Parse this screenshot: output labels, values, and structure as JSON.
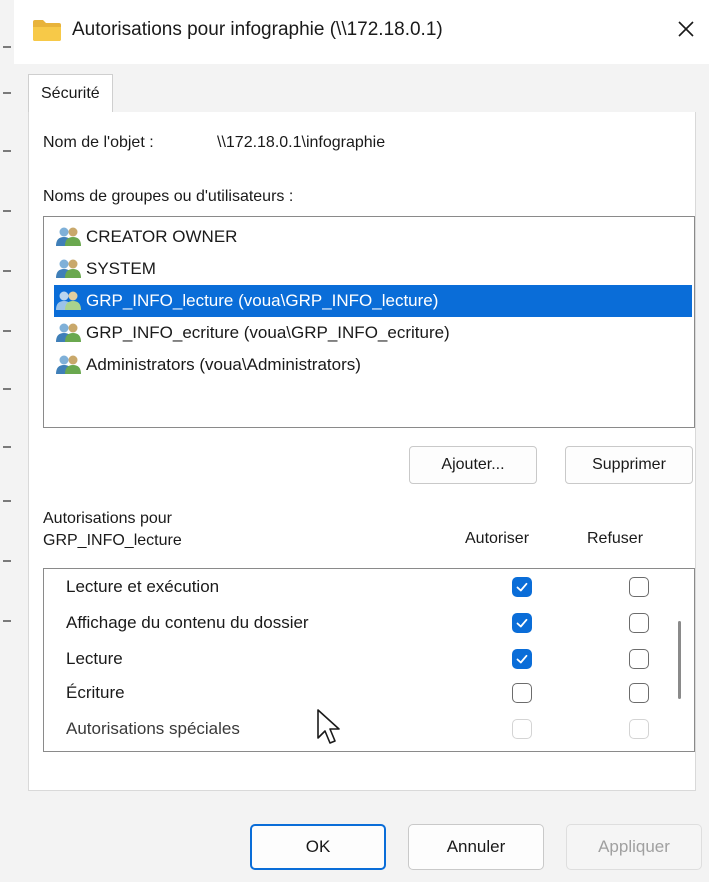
{
  "window": {
    "title": "Autorisations pour infographie (\\\\172.18.0.1)"
  },
  "tabs": [
    {
      "label": "Sécurité"
    }
  ],
  "object": {
    "label": "Nom de l'objet :",
    "value": "\\\\172.18.0.1\\infographie"
  },
  "groups": {
    "label": "Noms de groupes ou d'utilisateurs :",
    "items": [
      {
        "label": "CREATOR OWNER",
        "selected": false,
        "icon": "user-group-icon"
      },
      {
        "label": "SYSTEM",
        "selected": false,
        "icon": "user-group-icon"
      },
      {
        "label": "GRP_INFO_lecture (voua\\GRP_INFO_lecture)",
        "selected": true,
        "icon": "user-group-icon"
      },
      {
        "label": "GRP_INFO_ecriture (voua\\GRP_INFO_ecriture)",
        "selected": false,
        "icon": "user-group-icon"
      },
      {
        "label": "Administrators (voua\\Administrators)",
        "selected": false,
        "icon": "user-group-icon"
      }
    ],
    "add_label": "Ajouter...",
    "remove_label": "Supprimer"
  },
  "permissions": {
    "title_line1": "Autorisations pour",
    "title_line2": "GRP_INFO_lecture",
    "allow_header": "Autoriser",
    "deny_header": "Refuser",
    "rows": [
      {
        "name": "Lecture et exécution",
        "allow": "checked",
        "deny": "unchecked"
      },
      {
        "name": "Affichage du contenu du dossier",
        "allow": "checked",
        "deny": "unchecked"
      },
      {
        "name": "Lecture",
        "allow": "checked",
        "deny": "unchecked"
      },
      {
        "name": "Écriture",
        "allow": "unchecked",
        "deny": "unchecked"
      },
      {
        "name": "Autorisations spéciales",
        "allow": "disabled",
        "deny": "disabled"
      }
    ]
  },
  "footer": {
    "ok_label": "OK",
    "cancel_label": "Annuler",
    "apply_label": "Appliquer"
  },
  "colors": {
    "accent": "#0a6dd8",
    "disabled_text": "#a0a0a0"
  }
}
